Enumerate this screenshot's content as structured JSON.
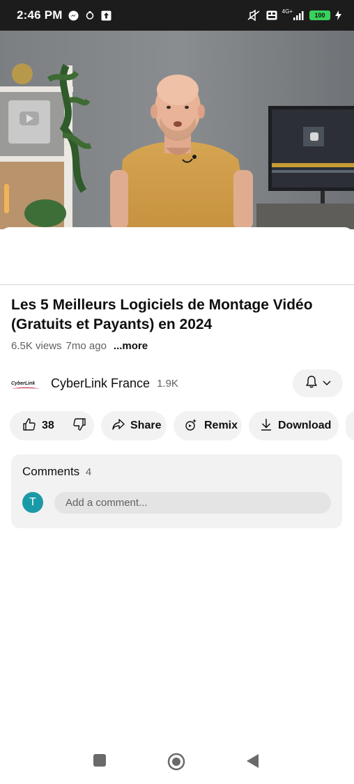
{
  "status_bar": {
    "time": "2:46 PM",
    "battery": "100",
    "network": "4G+",
    "icons": [
      "messenger-icon",
      "notification-icon",
      "upload-icon",
      "mute-icon",
      "volte-icon",
      "signal-icon",
      "battery-icon",
      "charging-icon"
    ]
  },
  "video": {
    "subject": "presenter-in-yellow-tshirt"
  },
  "title": "Les 5 Meilleurs Logiciels de Montage Vidéo (Gratuits et Payants) en 2024",
  "meta": {
    "views": "6.5K views",
    "age": "7mo ago",
    "more": "...more"
  },
  "channel": {
    "logo_text": "CyberLink",
    "name": "CyberLink France",
    "subscribers": "1.9K"
  },
  "actions": {
    "likes": "38",
    "share": "Share",
    "remix": "Remix",
    "download": "Download"
  },
  "comments": {
    "label": "Comments",
    "count": "4",
    "avatar_letter": "T",
    "placeholder": "Add a comment..."
  },
  "colors": {
    "avatar": "#1a9aa6",
    "pill_bg": "#f2f2f2",
    "status_bar": "#1c1c1c"
  }
}
